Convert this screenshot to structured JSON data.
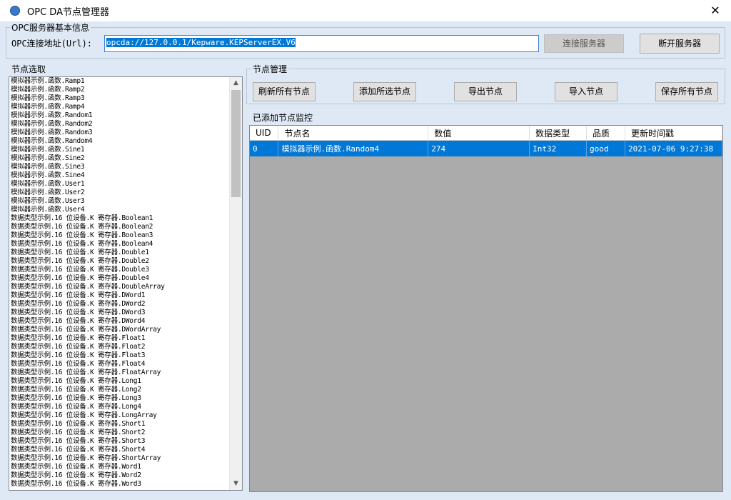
{
  "window": {
    "title": "OPC DA节点管理器",
    "close_glyph": "✕"
  },
  "server_group": {
    "label": "OPC服务器基本信息",
    "url_label": "OPC连接地址(Url):",
    "url_value": "opcda://127.0.0.1/Kepware.KEPServerEX.V6",
    "connect_label": "连接服务器",
    "disconnect_label": "断开服务器"
  },
  "node_select": {
    "label": "节点选取",
    "items": [
      "模拟器示例.函数.Ramp1",
      "模拟器示例.函数.Ramp2",
      "模拟器示例.函数.Ramp3",
      "模拟器示例.函数.Ramp4",
      "模拟器示例.函数.Random1",
      "模拟器示例.函数.Random2",
      "模拟器示例.函数.Random3",
      "模拟器示例.函数.Random4",
      "模拟器示例.函数.Sine1",
      "模拟器示例.函数.Sine2",
      "模拟器示例.函数.Sine3",
      "模拟器示例.函数.Sine4",
      "模拟器示例.函数.User1",
      "模拟器示例.函数.User2",
      "模拟器示例.函数.User3",
      "模拟器示例.函数.User4",
      "数据类型示例.16 位设备.K 寄存器.Boolean1",
      "数据类型示例.16 位设备.K 寄存器.Boolean2",
      "数据类型示例.16 位设备.K 寄存器.Boolean3",
      "数据类型示例.16 位设备.K 寄存器.Boolean4",
      "数据类型示例.16 位设备.K 寄存器.Double1",
      "数据类型示例.16 位设备.K 寄存器.Double2",
      "数据类型示例.16 位设备.K 寄存器.Double3",
      "数据类型示例.16 位设备.K 寄存器.Double4",
      "数据类型示例.16 位设备.K 寄存器.DoubleArray",
      "数据类型示例.16 位设备.K 寄存器.DWord1",
      "数据类型示例.16 位设备.K 寄存器.DWord2",
      "数据类型示例.16 位设备.K 寄存器.DWord3",
      "数据类型示例.16 位设备.K 寄存器.DWord4",
      "数据类型示例.16 位设备.K 寄存器.DWordArray",
      "数据类型示例.16 位设备.K 寄存器.Float1",
      "数据类型示例.16 位设备.K 寄存器.Float2",
      "数据类型示例.16 位设备.K 寄存器.Float3",
      "数据类型示例.16 位设备.K 寄存器.Float4",
      "数据类型示例.16 位设备.K 寄存器.FloatArray",
      "数据类型示例.16 位设备.K 寄存器.Long1",
      "数据类型示例.16 位设备.K 寄存器.Long2",
      "数据类型示例.16 位设备.K 寄存器.Long3",
      "数据类型示例.16 位设备.K 寄存器.Long4",
      "数据类型示例.16 位设备.K 寄存器.LongArray",
      "数据类型示例.16 位设备.K 寄存器.Short1",
      "数据类型示例.16 位设备.K 寄存器.Short2",
      "数据类型示例.16 位设备.K 寄存器.Short3",
      "数据类型示例.16 位设备.K 寄存器.Short4",
      "数据类型示例.16 位设备.K 寄存器.ShortArray",
      "数据类型示例.16 位设备.K 寄存器.Word1",
      "数据类型示例.16 位设备.K 寄存器.Word2",
      "数据类型示例.16 位设备.K 寄存器.Word3"
    ]
  },
  "node_manage": {
    "label": "节点管理",
    "buttons": [
      "刷新所有节点",
      "添加所选节点",
      "导出节点",
      "导入节点",
      "保存所有节点"
    ]
  },
  "monitor": {
    "label": "已添加节点监控",
    "columns": [
      "UID",
      "节点名",
      "数值",
      "数据类型",
      "品质",
      "更新时间戳"
    ],
    "rows": [
      [
        "0",
        "模拟器示例.函数.Random4",
        "274",
        "Int32",
        "good",
        "2021-07-06 9:27:38"
      ]
    ]
  },
  "colors": {
    "selection": "#0078d7",
    "window_bg": "#dfe9f5",
    "grid_bg": "#ababab"
  }
}
